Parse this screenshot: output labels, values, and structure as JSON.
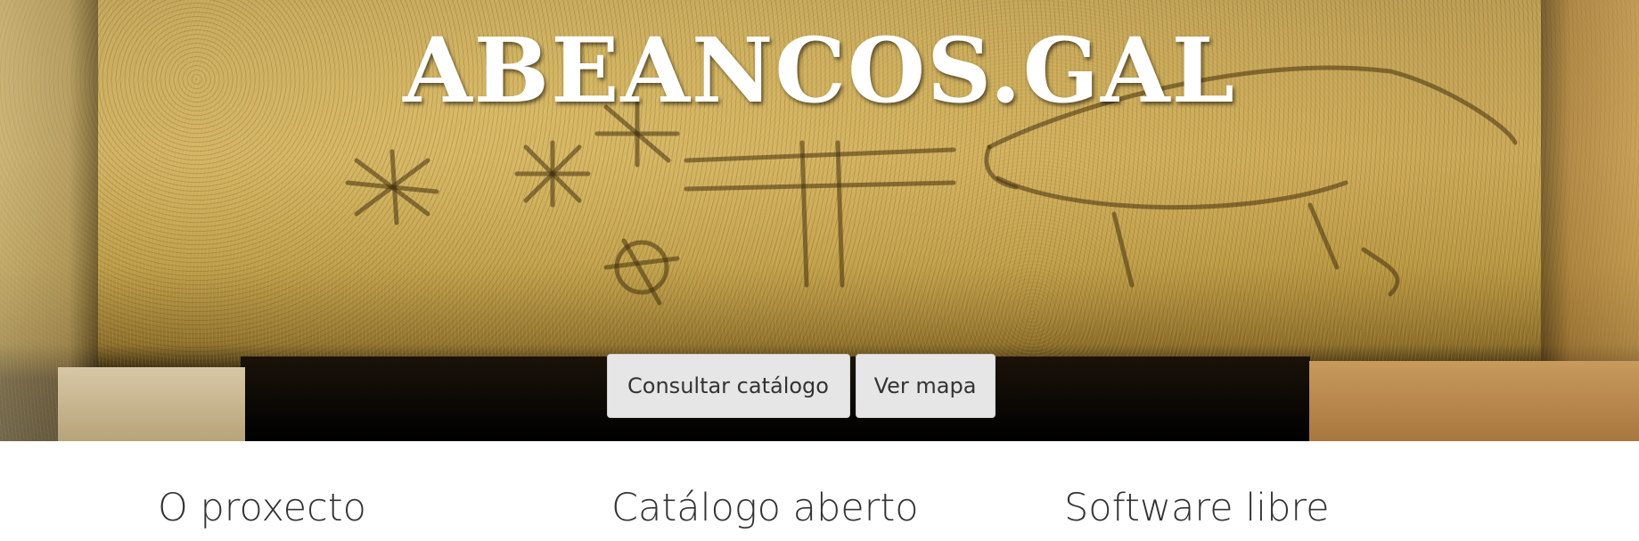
{
  "hero": {
    "title": "ABEANCOS.GAL"
  },
  "actions": {
    "catalog_label": "Consultar catálogo",
    "map_label": "Ver mapa"
  },
  "features": [
    {
      "heading": "O proxecto"
    },
    {
      "heading": "Catálogo aberto"
    },
    {
      "heading": "Software libre"
    }
  ]
}
